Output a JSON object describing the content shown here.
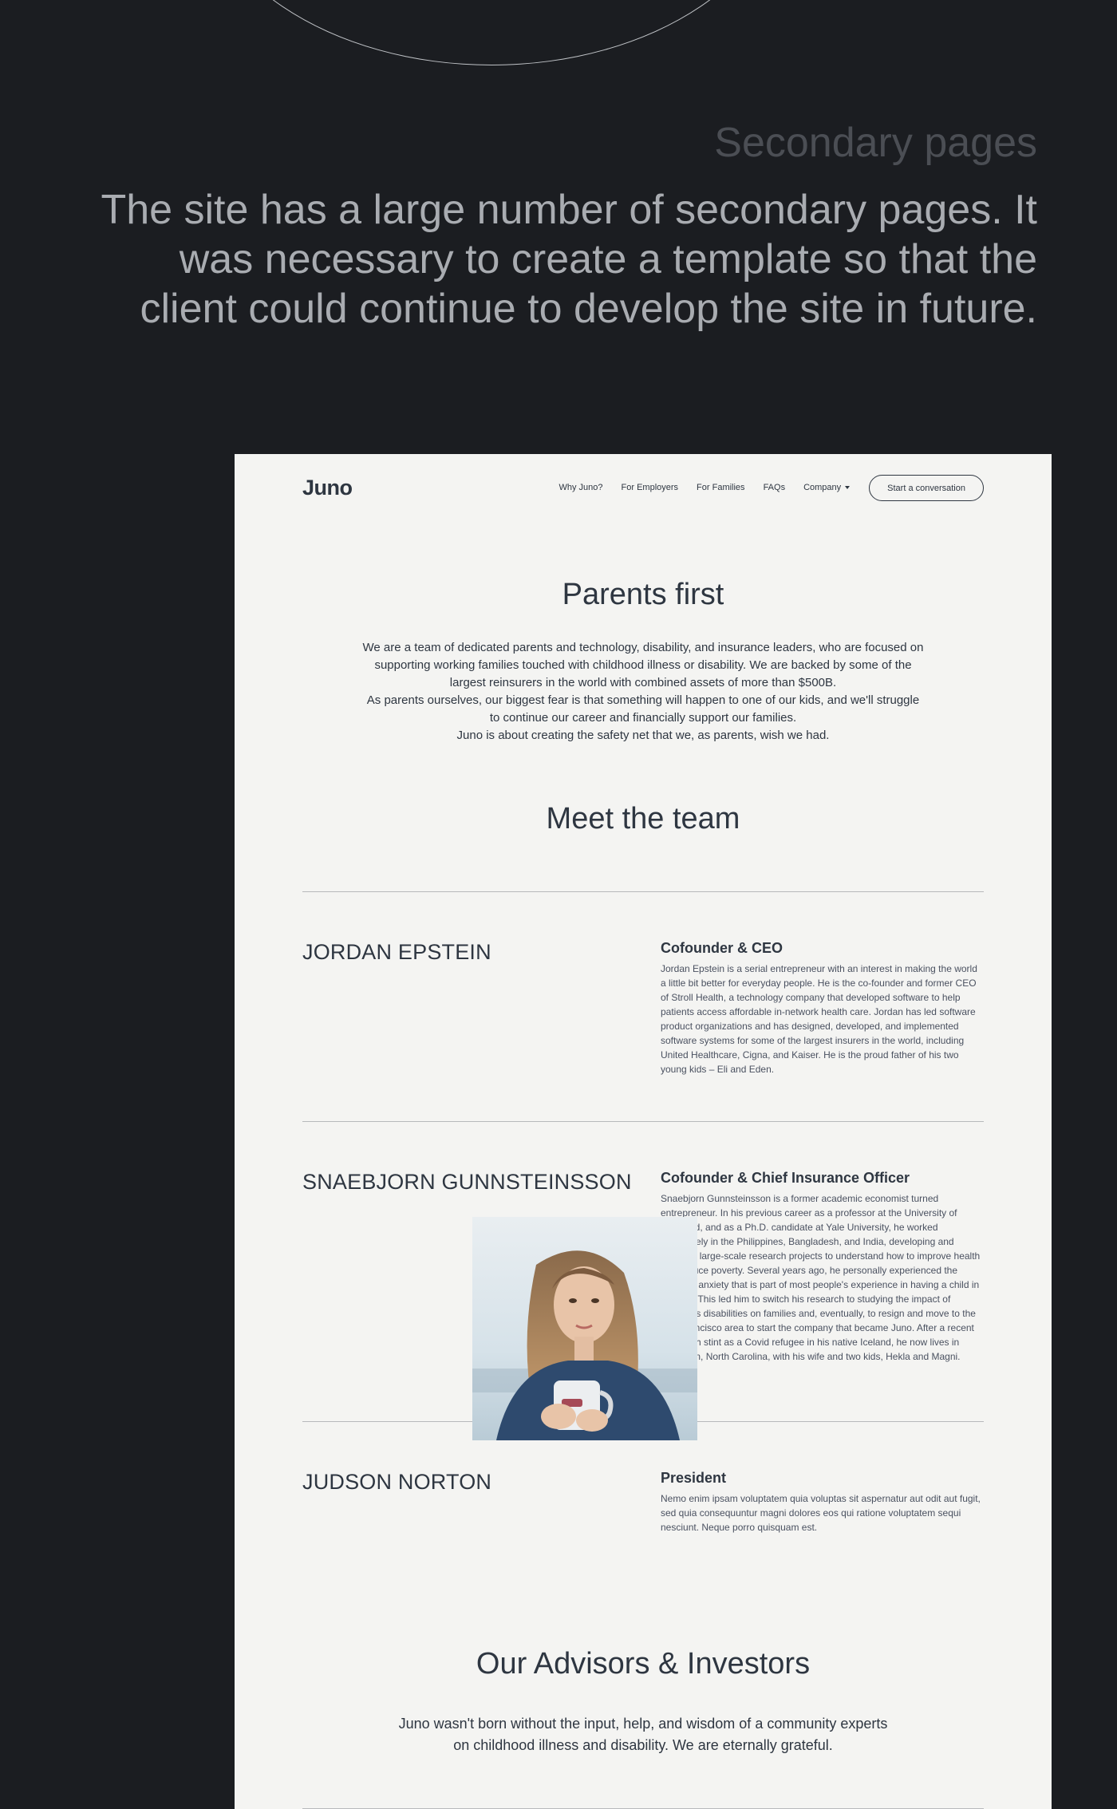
{
  "intro": {
    "title": "Secondary pages",
    "text": "The site has a large number of secondary pages. It was necessary to create a template so that the client could continue to develop the site in future."
  },
  "nav": {
    "logo": "Juno",
    "links": [
      "Why Juno?",
      "For Employers",
      "For Families",
      "FAQs",
      "Company"
    ],
    "cta": "Start a conversation"
  },
  "parents": {
    "title": "Parents first",
    "paragraph1": "We are a team of dedicated parents and technology, disability, and insurance leaders, who are focused on supporting working families touched with childhood illness or disability. We are backed by some of the largest reinsurers in the world with combined assets of more than $500B.",
    "paragraph2": "As parents ourselves, our biggest fear is that something will happen to one of our kids, and we'll struggle to continue our career and financially support our families.",
    "paragraph3": "Juno is about creating the safety net that we, as parents, wish we had."
  },
  "team": {
    "title": "Meet the team",
    "members": [
      {
        "name": "JORDAN EPSTEIN",
        "role": "Cofounder & CEO",
        "bio": "Jordan Epstein is a serial entrepreneur with an interest in making the world a little bit better for everyday people. He is the co-founder and former CEO of Stroll Health, a technology company that developed software to help patients access affordable in-network health care. Jordan has led software product organizations and has designed, developed, and implemented software systems for some of the largest insurers in the world, including United Healthcare, Cigna, and Kaiser. He is the proud father of his two young kids – Eli and Eden."
      },
      {
        "name": "SNAEBJORN GUNNSTEINSSON",
        "role": "Cofounder & Chief Insurance Officer",
        "bio": "Snaebjorn Gunnsteinsson is a former academic economist turned entrepreneur. In his previous career as a professor at the University of Maryland, and as a Ph.D. candidate at Yale University, he worked extensively in the Philippines, Bangladesh, and India, developing and directing large-scale research projects to understand how to improve health and reduce poverty. Several years ago, he personally experienced the financial anxiety that is part of most people's experience in having a child in the U.S. This led him to switch his research to studying the impact of children's disabilities on families and, eventually, to resign and move to the San Francisco area to start the company that became Juno. After a recent 15-month stint as a Covid refugee in his native Iceland, he now lives in Davidson, North Carolina, with his wife and two kids, Hekla and Magni."
      },
      {
        "name": "JUDSON NORTON",
        "role": "President",
        "bio": "Nemo enim ipsam voluptatem quia voluptas sit aspernatur aut odit aut fugit, sed quia consequuntur magni dolores eos qui ratione voluptatem sequi nesciunt. Neque porro quisquam est."
      }
    ]
  },
  "advisors": {
    "title": "Our Advisors & Investors",
    "text": "Juno wasn't born without the input, help, and wisdom of a community experts on childhood illness and disability. We are eternally grateful."
  },
  "colors": {
    "background": "#1b1d21",
    "page": "#f4f4f2",
    "text": "#2e3641"
  }
}
